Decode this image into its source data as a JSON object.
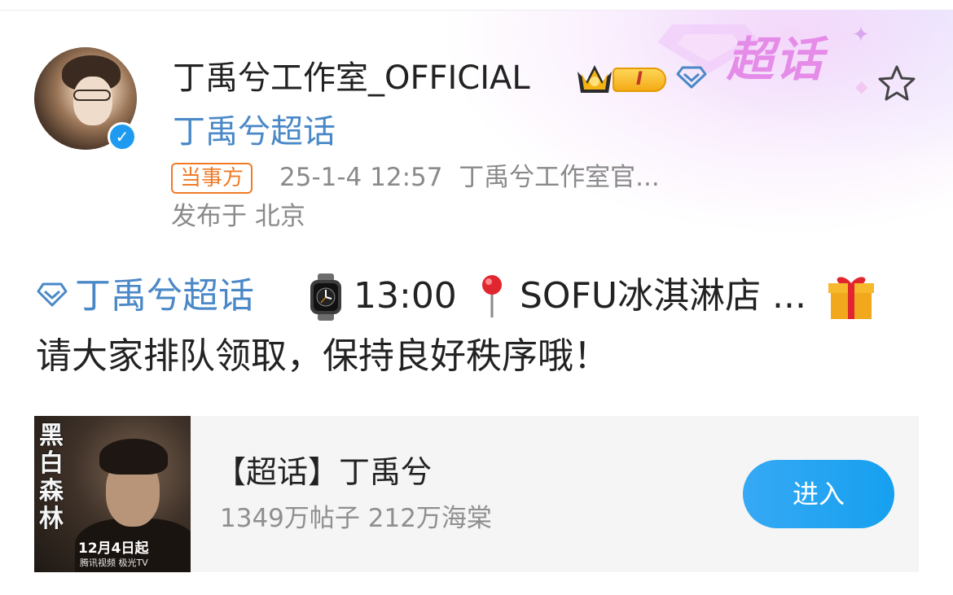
{
  "header": {
    "supertopic_badge": "超话",
    "username": "丁禹兮工作室_OFFICIAL",
    "level_badge": "I",
    "topic_link": "丁禹兮超话",
    "party_tag": "当事方",
    "timestamp": "25-1-4 12:57",
    "source": "丁禹兮工作室官...",
    "location_prefix": "发布于",
    "location": "北京"
  },
  "post": {
    "topic": "丁禹兮超话",
    "time": "13:00",
    "place": "SOFU冰淇淋店 ...",
    "line2": "请大家排队领取，保持良好秩序哦！"
  },
  "card": {
    "title": "【超话】丁禹兮",
    "posts_count": "1349万帖子",
    "fans_count": "212万海棠",
    "enter_label": "进入",
    "poster": {
      "title": "黑白森林",
      "date": "12月4日起",
      "platform": "腾讯视频 极光TV"
    }
  },
  "colors": {
    "link_blue": "#4a88c7",
    "tag_orange": "#f07b27",
    "button_blue": "#1e9bf0",
    "badge_pink": "#e58be8"
  },
  "icons": [
    "star-icon",
    "crown-icon",
    "diamond-icon",
    "verified-icon",
    "watch-icon",
    "pin-icon",
    "gift-icon"
  ]
}
